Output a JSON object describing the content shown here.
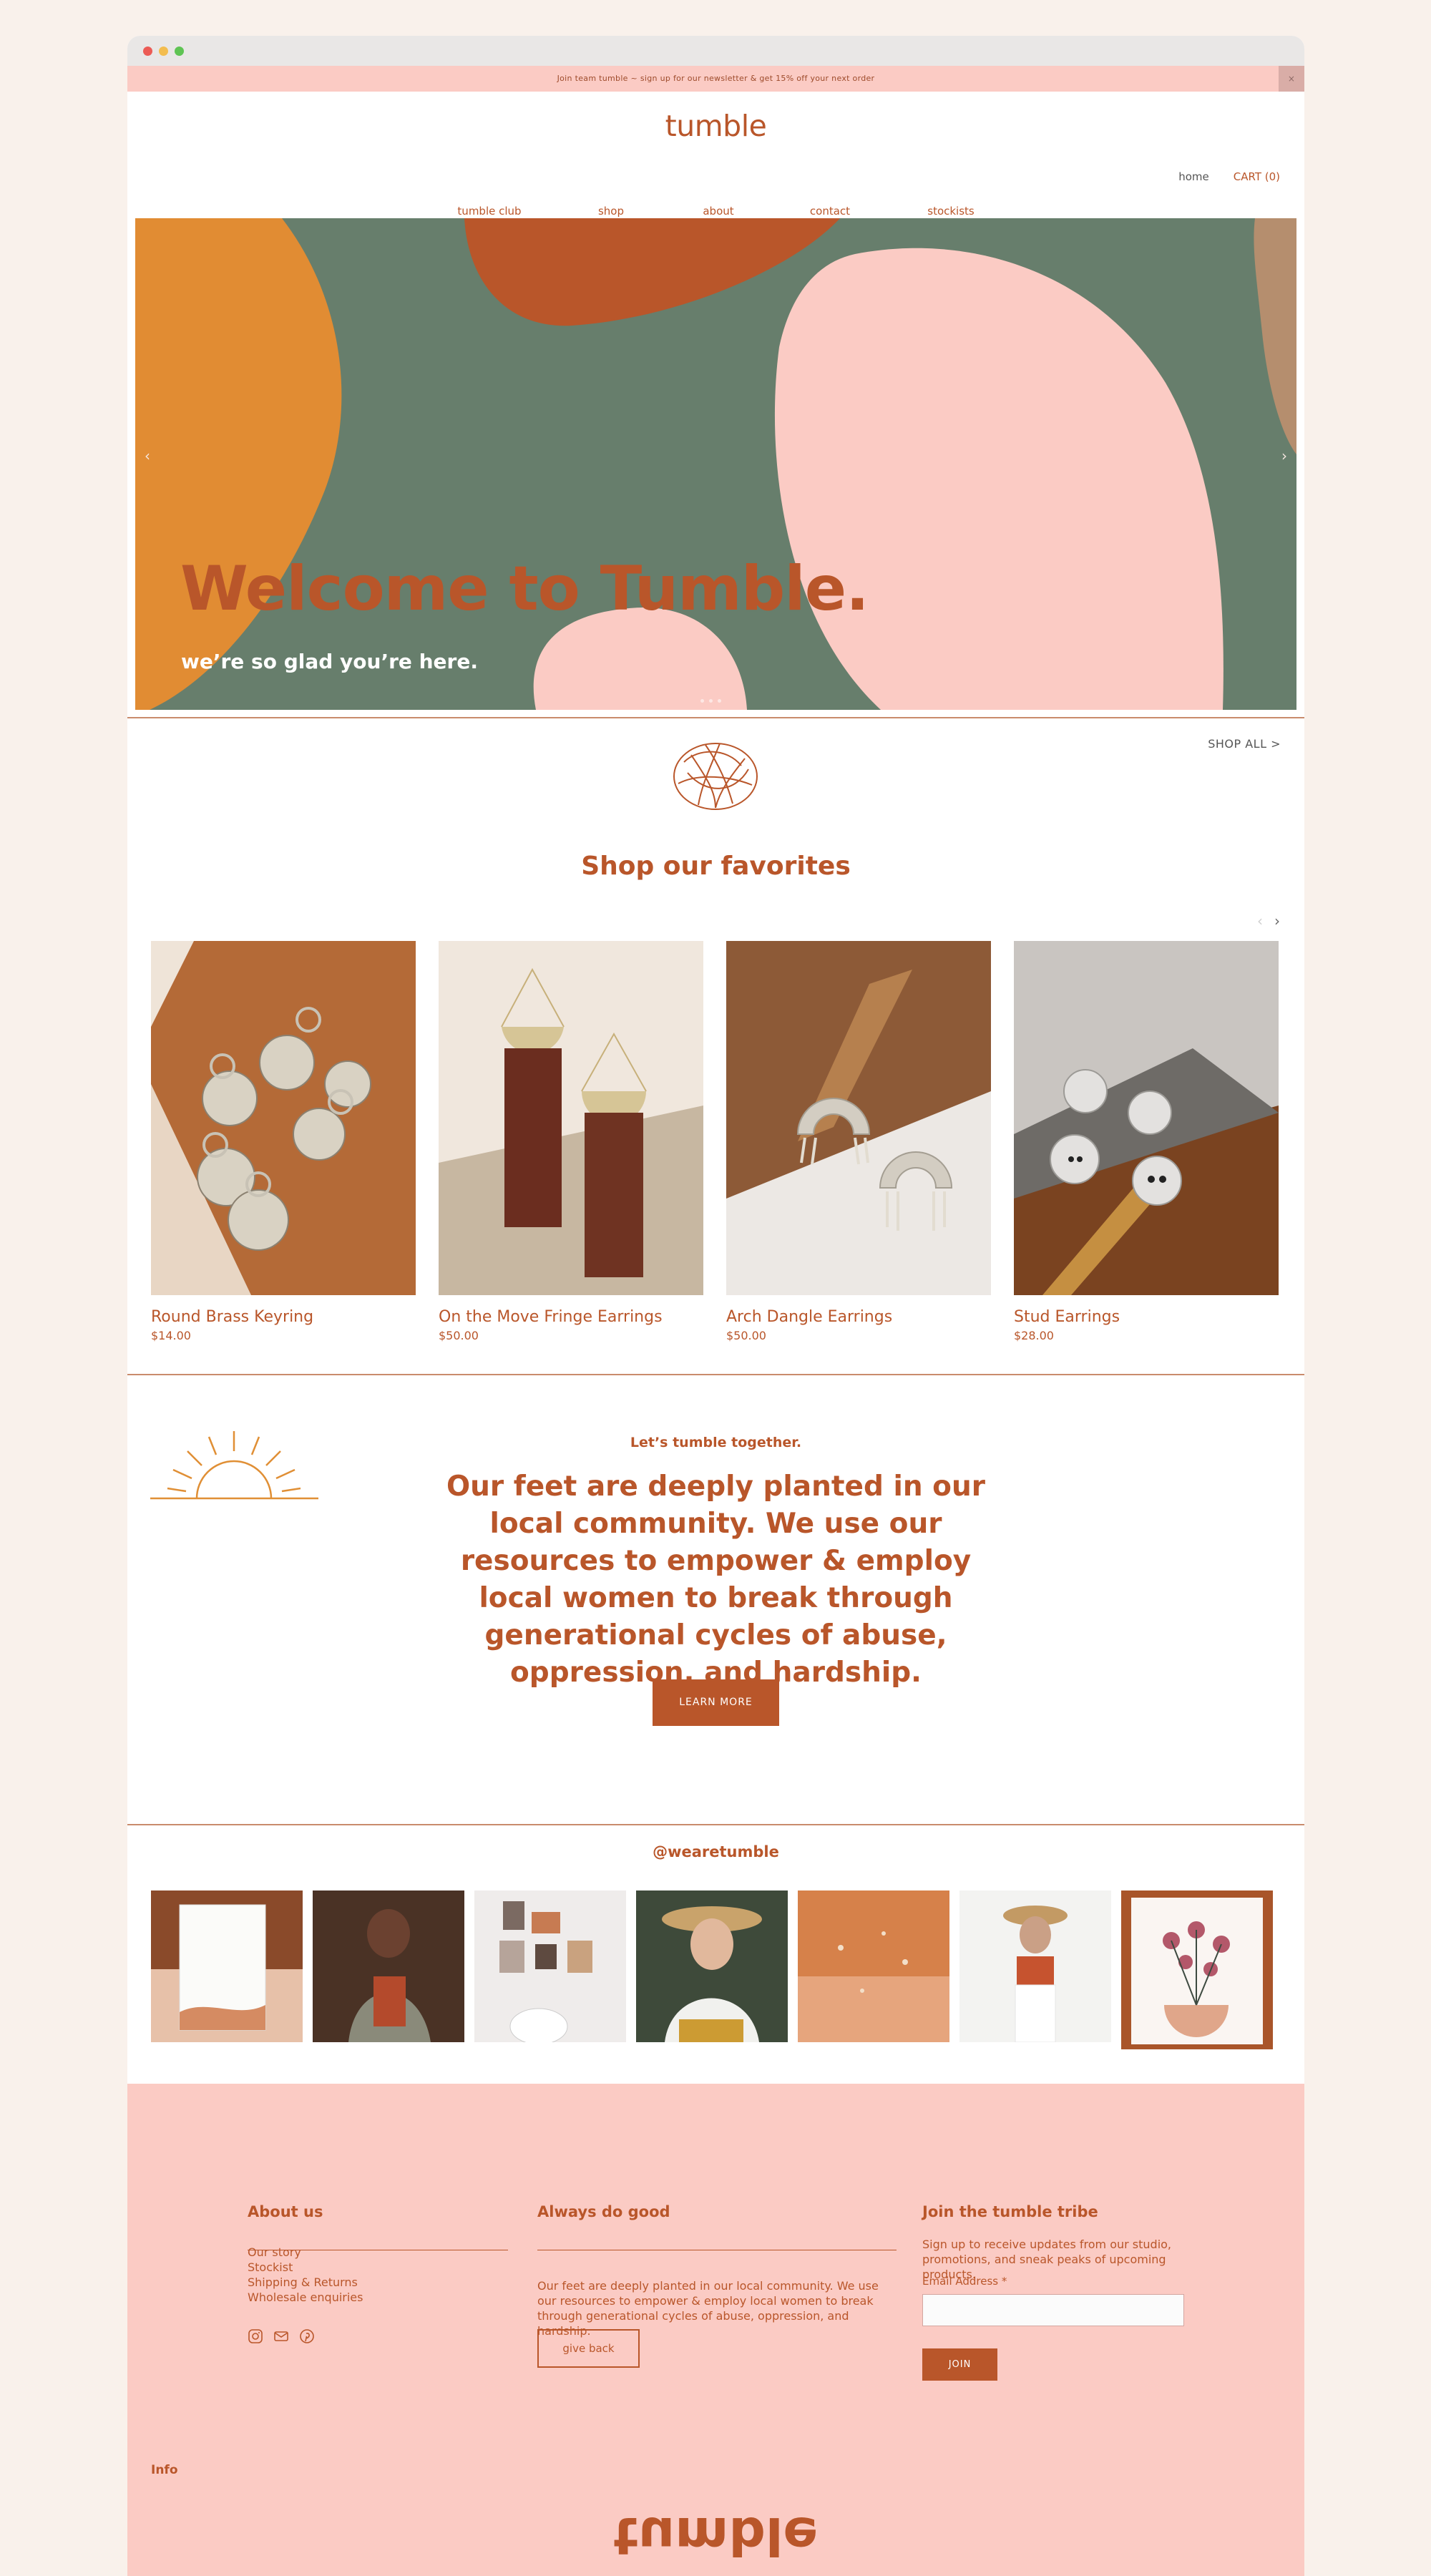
{
  "announcement": {
    "text": "Join team tumble ~ sign up for our newsletter & get 15% off your next order",
    "close_label": "×"
  },
  "brand": {
    "logo": "tumble"
  },
  "utility_nav": {
    "home": "home",
    "cart": "CART (0)"
  },
  "main_nav": [
    "tumble club",
    "shop",
    "about",
    "contact",
    "stockists"
  ],
  "hero": {
    "title": "Welcome to Tumble.",
    "subtitle": "we’re so glad you’re here.",
    "prev_arrow": "‹",
    "next_arrow": "›",
    "colors": {
      "background": "#677e6c",
      "orange": "#e18c33",
      "rust": "#b9562a",
      "pink": "#fbcbc4",
      "tan": "#b58e6e"
    }
  },
  "favorites": {
    "shop_all": "SHOP ALL >",
    "title": "Shop our favorites",
    "prev": "‹",
    "next": "›",
    "products": [
      {
        "name": "Round Brass Keyring",
        "price": "$14.00"
      },
      {
        "name": "On the Move Fringe Earrings",
        "price": "$50.00"
      },
      {
        "name": "Arch Dangle Earrings",
        "price": "$50.00"
      },
      {
        "name": "Stud Earrings",
        "price": "$28.00"
      }
    ]
  },
  "mission": {
    "kicker": "Let’s tumble together.",
    "body": "Our feet are deeply planted in our local community. We use our resources to empower & employ local women to break through generational cycles of abuse, oppression, and hardship.",
    "button": "LEARN MORE"
  },
  "instagram": {
    "handle": "@wearetumble"
  },
  "footer": {
    "about_heading": "About us",
    "about_links": [
      "Our story",
      "Stockist",
      "Shipping & Returns",
      "Wholesale enquiries"
    ],
    "social_icons": [
      "instagram-icon",
      "mail-icon",
      "pinterest-icon"
    ],
    "good_heading": "Always do good",
    "good_text": "Our feet are deeply planted in our local community. We use our resources to empower & employ local women to break through generational cycles of abuse, oppression, and hardship.",
    "give_back": "give back",
    "tribe_heading": "Join the tumble tribe",
    "tribe_text": "Sign up to receive updates from our studio, promotions, and sneak peaks of upcoming products.",
    "email_label": "Email Address *",
    "email_value": "",
    "join": "JOIN",
    "info": "Info",
    "logo": "tumble"
  },
  "accent_color": "#b9562a",
  "footer_color": "#fbcbc4"
}
